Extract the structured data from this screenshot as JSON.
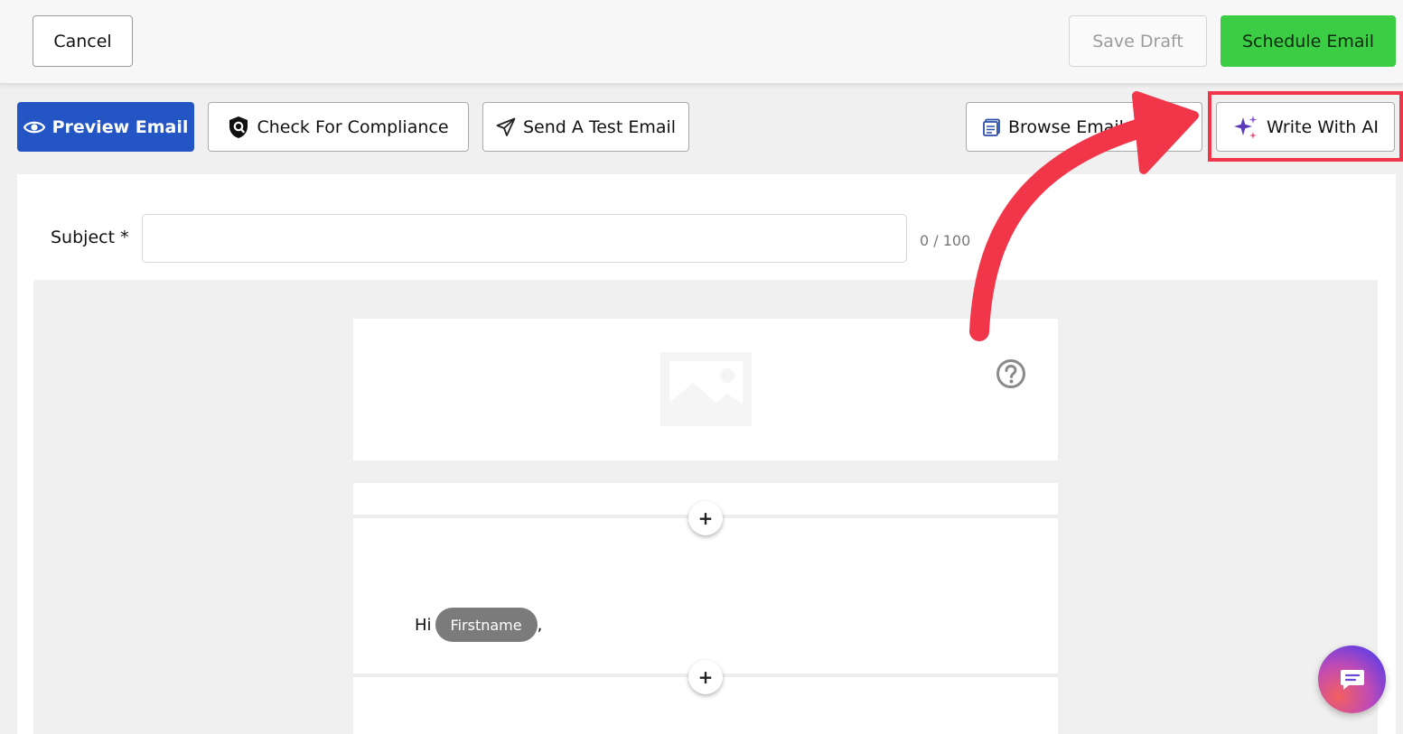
{
  "toolbar": {
    "cancel_label": "Cancel",
    "save_draft_label": "Save Draft",
    "schedule_label": "Schedule Email"
  },
  "actions": {
    "preview_label": "Preview Email",
    "compliance_label": "Check For Compliance",
    "test_label": "Send A Test Email",
    "browse_label": "Browse Email ",
    "ai_label": "Write With AI"
  },
  "subject": {
    "label": "Subject *",
    "value": "",
    "counter": "0 / 100"
  },
  "email_body": {
    "greeting": "Hi",
    "merge_tag": "Firstname",
    "comma": ",",
    "add_block_symbol": "+"
  },
  "colors": {
    "primary": "#2355c4",
    "schedule_green": "#3bcd44",
    "highlight_red": "#f2364a"
  },
  "icons": {
    "preview": "eye-icon",
    "compliance": "shield-search-icon",
    "test": "paper-plane-icon",
    "browse": "template-icon",
    "ai": "sparkle-icon",
    "image": "image-placeholder-icon",
    "help": "question-icon",
    "chat": "chat-icon"
  }
}
